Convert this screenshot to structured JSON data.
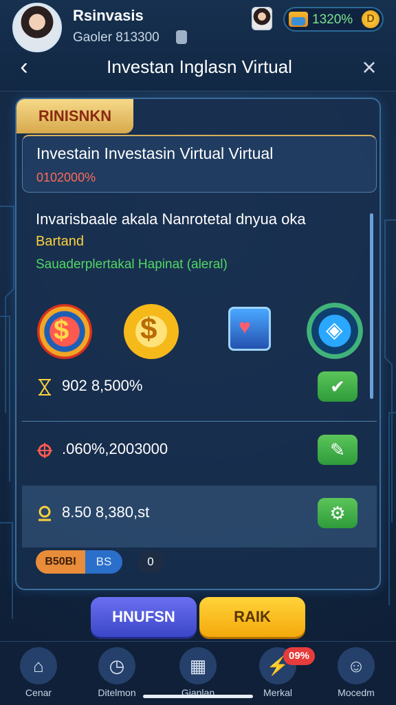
{
  "header": {
    "user_name": "Rsinvasis",
    "user_subtitle": "Gaoler 813300",
    "balance": "1320%",
    "coin_symbol": "D",
    "title": "Investan Inglasn Virtual"
  },
  "panel": {
    "tab_label": "RINISNKN",
    "info_title": "Investain Investasin Virtual Virtual",
    "info_rate": "0102000%",
    "description": "Invarisbaale akala Nanrotetal dnyua oka",
    "status_yellow": "Bartand",
    "status_green": "Sauaderplertakal Hapinat (aleral)",
    "icons": [
      "dollar-target-icon",
      "gold-coin-icon",
      "heart-tablet-icon",
      "shield-app-icon"
    ],
    "rows": [
      {
        "value": "902 8,500%",
        "action_icon": "check-icon"
      },
      {
        "value": ".060%,2003000",
        "action_icon": "edit-icon"
      },
      {
        "value": "8.50 8,380,st",
        "action_icon": "gear-icon"
      }
    ],
    "chips": {
      "left": "B50BI",
      "middle": "BS",
      "right": "0"
    }
  },
  "buttons": {
    "left": "HNUFSN",
    "right": "RAIK"
  },
  "nav": {
    "items": [
      {
        "label": "Cenar"
      },
      {
        "label": "Ditelmon"
      },
      {
        "label": "Gianlan"
      },
      {
        "label": "Merkal",
        "badge": "09%"
      },
      {
        "label": "Mocedm"
      }
    ]
  },
  "colors": {
    "accent_gold": "#d7a94c",
    "action_green": "#2e9b3b",
    "rate_red": "#ff6a5a",
    "balance_green": "#7de38f"
  }
}
